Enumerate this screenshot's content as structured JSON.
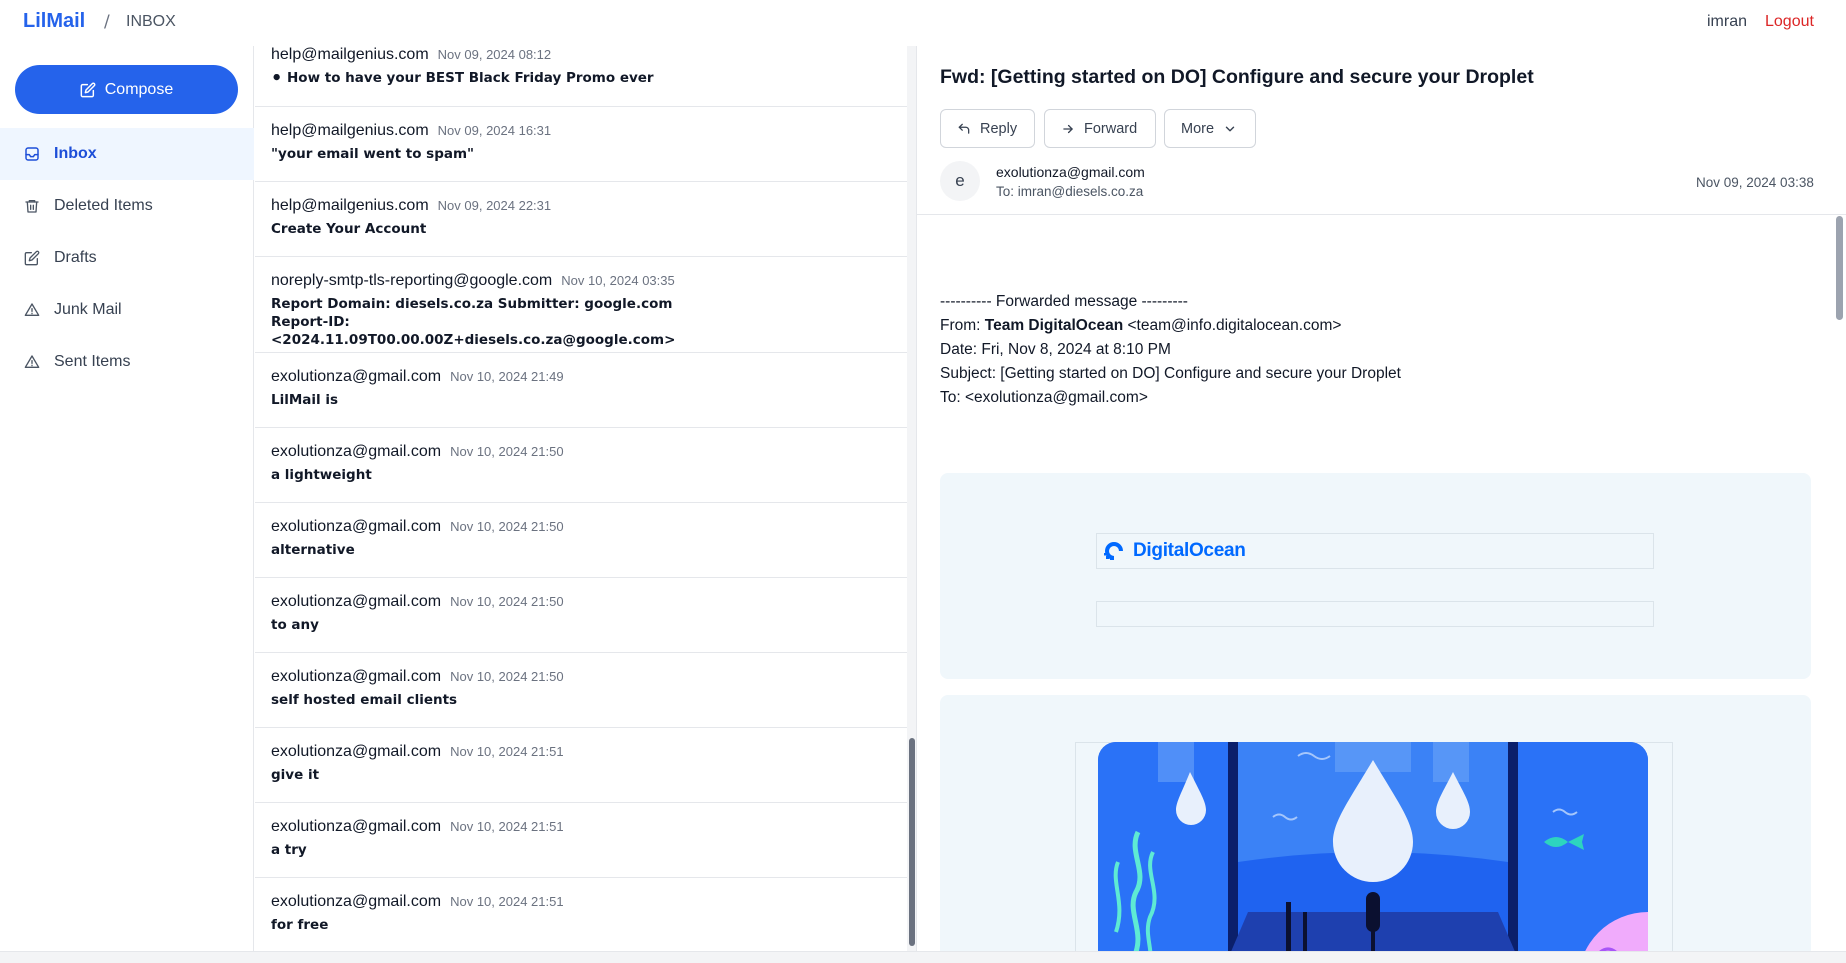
{
  "header": {
    "brand": "LilMail",
    "separator": "/",
    "breadcrumb": "INBOX",
    "user": "imran",
    "logout": "Logout"
  },
  "sidebar": {
    "compose_label": "Compose",
    "items": [
      {
        "label": "Inbox",
        "icon": "inbox-icon",
        "active": true
      },
      {
        "label": "Deleted Items",
        "icon": "trash-icon",
        "active": false
      },
      {
        "label": "Drafts",
        "icon": "edit-icon",
        "active": false
      },
      {
        "label": "Junk Mail",
        "icon": "warning-icon",
        "active": false
      },
      {
        "label": "Sent Items",
        "icon": "warning-icon",
        "active": false
      }
    ]
  },
  "messages": [
    {
      "from": "help@mailgenius.com",
      "date": "Nov 09, 2024 08:12",
      "subject": "⚫ How to have your BEST Black Friday Promo ever"
    },
    {
      "from": "help@mailgenius.com",
      "date": "Nov 09, 2024 16:31",
      "subject": "\"your email went to spam\""
    },
    {
      "from": "help@mailgenius.com",
      "date": "Nov 09, 2024 22:31",
      "subject": "Create Your Account"
    },
    {
      "from": "noreply-smtp-tls-reporting@google.com",
      "date": "Nov 10, 2024 03:35",
      "subject": "Report Domain: diesels.co.za Submitter: google.com Report-ID: <2024.11.09T00.00.00Z+diesels.co.za@google.com>"
    },
    {
      "from": "exolutionza@gmail.com",
      "date": "Nov 10, 2024 21:49",
      "subject": "LilMail is"
    },
    {
      "from": "exolutionza@gmail.com",
      "date": "Nov 10, 2024 21:50",
      "subject": "a lightweight"
    },
    {
      "from": "exolutionza@gmail.com",
      "date": "Nov 10, 2024 21:50",
      "subject": "alternative"
    },
    {
      "from": "exolutionza@gmail.com",
      "date": "Nov 10, 2024 21:50",
      "subject": "to any"
    },
    {
      "from": "exolutionza@gmail.com",
      "date": "Nov 10, 2024 21:50",
      "subject": "self hosted email clients"
    },
    {
      "from": "exolutionza@gmail.com",
      "date": "Nov 10, 2024 21:51",
      "subject": "give it"
    },
    {
      "from": "exolutionza@gmail.com",
      "date": "Nov 10, 2024 21:51",
      "subject": "a try"
    },
    {
      "from": "exolutionza@gmail.com",
      "date": "Nov 10, 2024 21:51",
      "subject": "for free"
    }
  ],
  "reader": {
    "subject": "Fwd: [Getting started on DO] Configure and secure your Droplet",
    "buttons": {
      "reply": "Reply",
      "forward": "Forward",
      "more": "More"
    },
    "avatar_letter": "e",
    "sender": "exolutionza@gmail.com",
    "to": "To: imran@diesels.co.za",
    "date": "Nov 09, 2024 03:38",
    "body": {
      "forward_line": "---------- Forwarded message ---------",
      "from_label": "From: ",
      "from_name": "Team DigitalOcean",
      "from_email": " <team@info.digitalocean.com>",
      "date_line": "Date: Fri, Nov 8, 2024 at 8:10 PM",
      "subject_line": "Subject: [Getting started on DO] Configure and secure your Droplet",
      "to_line": "To: <exolutionza@gmail.com>"
    },
    "logo_text": "DigitalOcean",
    "colors": {
      "accent": "#2563eb",
      "logout": "#dc2626",
      "do_blue": "#0069ff"
    }
  }
}
